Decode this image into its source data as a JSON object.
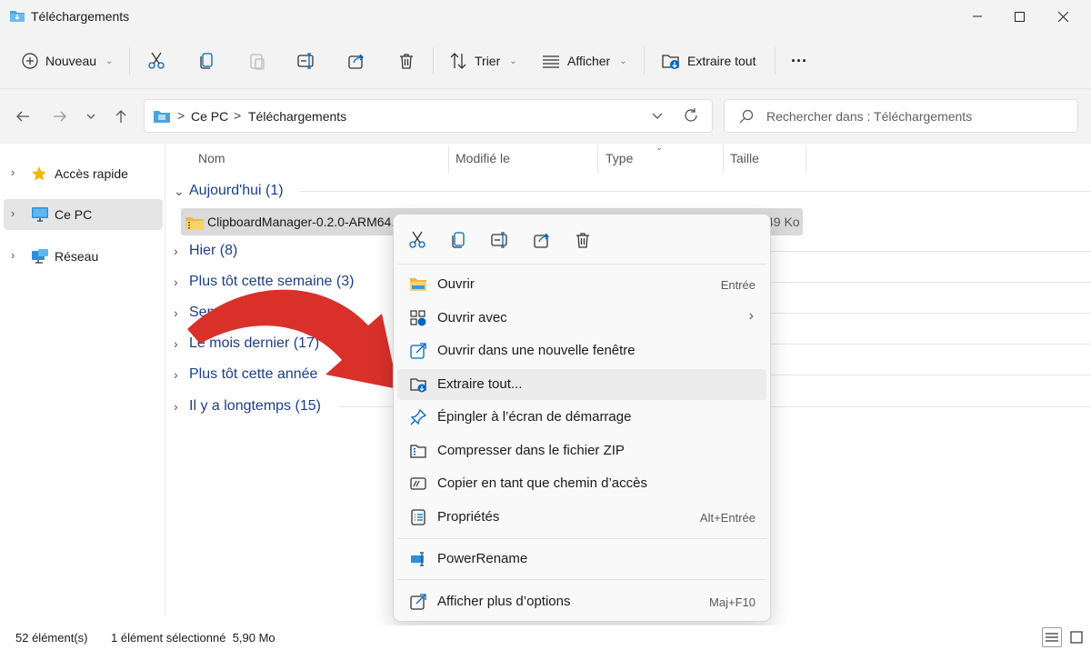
{
  "window": {
    "title": "Téléchargements",
    "folder_icon": "folder-downloads-icon",
    "min_icon": "minimize-icon",
    "max_icon": "maximize-icon",
    "close_icon": "close-icon"
  },
  "toolbar": {
    "new_label": "Nouveau",
    "sort_label": "Trier",
    "view_label": "Afficher",
    "extract_label": "Extraire tout",
    "more_label": "···"
  },
  "address": {
    "crumbs": [
      "Ce PC",
      "Téléchargements"
    ],
    "separator": ">",
    "search_placeholder": "Rechercher dans : Téléchargements"
  },
  "sidebar": {
    "items": [
      {
        "label": "Accès rapide",
        "icon": "star-icon"
      },
      {
        "label": "Ce PC",
        "icon": "pc-icon"
      },
      {
        "label": "Réseau",
        "icon": "network-icon"
      }
    ]
  },
  "columns": {
    "name": "Nom",
    "modified": "Modifié le",
    "type": "Type",
    "size": "Taille"
  },
  "groups": [
    "Aujourd'hui (1)",
    "Hier (8)",
    "Plus tôt cette semaine (3)",
    "Semaine dernière",
    "Le mois dernier (17)",
    "Plus tôt cette année",
    "Il y a longtemps (15)"
  ],
  "file": {
    "name": "ClipboardManager-0.2.0-ARM64.z",
    "size": "49 Ko"
  },
  "context_menu": {
    "quick_icons": [
      "cut-icon",
      "copy-icon",
      "rename-icon",
      "share-icon",
      "delete-icon"
    ],
    "items": [
      {
        "label": "Ouvrir",
        "shortcut": "Entrée",
        "icon": "folder-open-icon"
      },
      {
        "label": "Ouvrir avec",
        "shortcut": "",
        "icon": "open-with-icon",
        "submenu": true
      },
      {
        "label": "Ouvrir dans une nouvelle fenêtre",
        "shortcut": "",
        "icon": "new-window-icon"
      },
      {
        "label": "Extraire tout...",
        "shortcut": "",
        "icon": "extract-icon"
      },
      {
        "label": "Épingler à l’écran de démarrage",
        "shortcut": "",
        "icon": "pin-icon"
      },
      {
        "label": "Compresser dans le fichier ZIP",
        "shortcut": "",
        "icon": "zip-icon"
      },
      {
        "label": "Copier en tant que chemin d’accès",
        "shortcut": "",
        "icon": "copy-path-icon"
      },
      {
        "label": "Propriétés",
        "shortcut": "Alt+Entrée",
        "icon": "properties-icon"
      },
      {
        "label": "PowerRename",
        "shortcut": "",
        "icon": "powerrename-icon"
      },
      {
        "label": "Afficher plus d’options",
        "shortcut": "Maj+F10",
        "icon": "more-options-icon"
      }
    ]
  },
  "status": {
    "count": "52 élément(s)",
    "selection": "1 élément sélectionné  5,90 Mo"
  },
  "colors": {
    "accent": "#0067c0",
    "group_text": "#1c3d8c",
    "arrow": "#d9302a"
  }
}
